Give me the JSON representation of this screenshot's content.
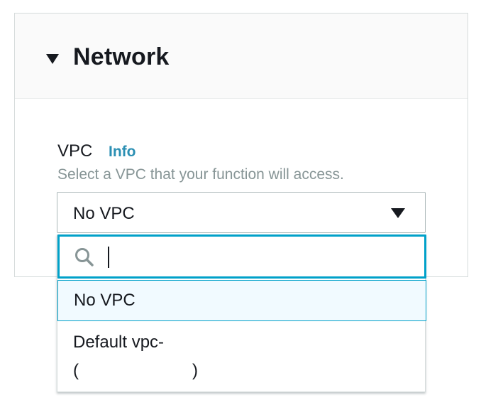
{
  "panel": {
    "title": "Network",
    "collapse_icon": "caret-down-icon"
  },
  "vpc_field": {
    "label": "VPC",
    "info_link": "Info",
    "description": "Select a VPC that your function will access.",
    "selected_value": "No VPC",
    "dropdown_icon": "caret-down-icon"
  },
  "dropdown": {
    "search": {
      "icon": "search-icon",
      "value": "",
      "placeholder": ""
    },
    "options": [
      {
        "label": "No VPC",
        "selected": true
      },
      {
        "label": "Default vpc-",
        "detail": "(                        )"
      }
    ]
  },
  "colors": {
    "accent": "#00a1c9",
    "link": "#2b8fb3",
    "text": "#16191f",
    "muted": "#879596",
    "highlight_bg": "#f1faff"
  }
}
